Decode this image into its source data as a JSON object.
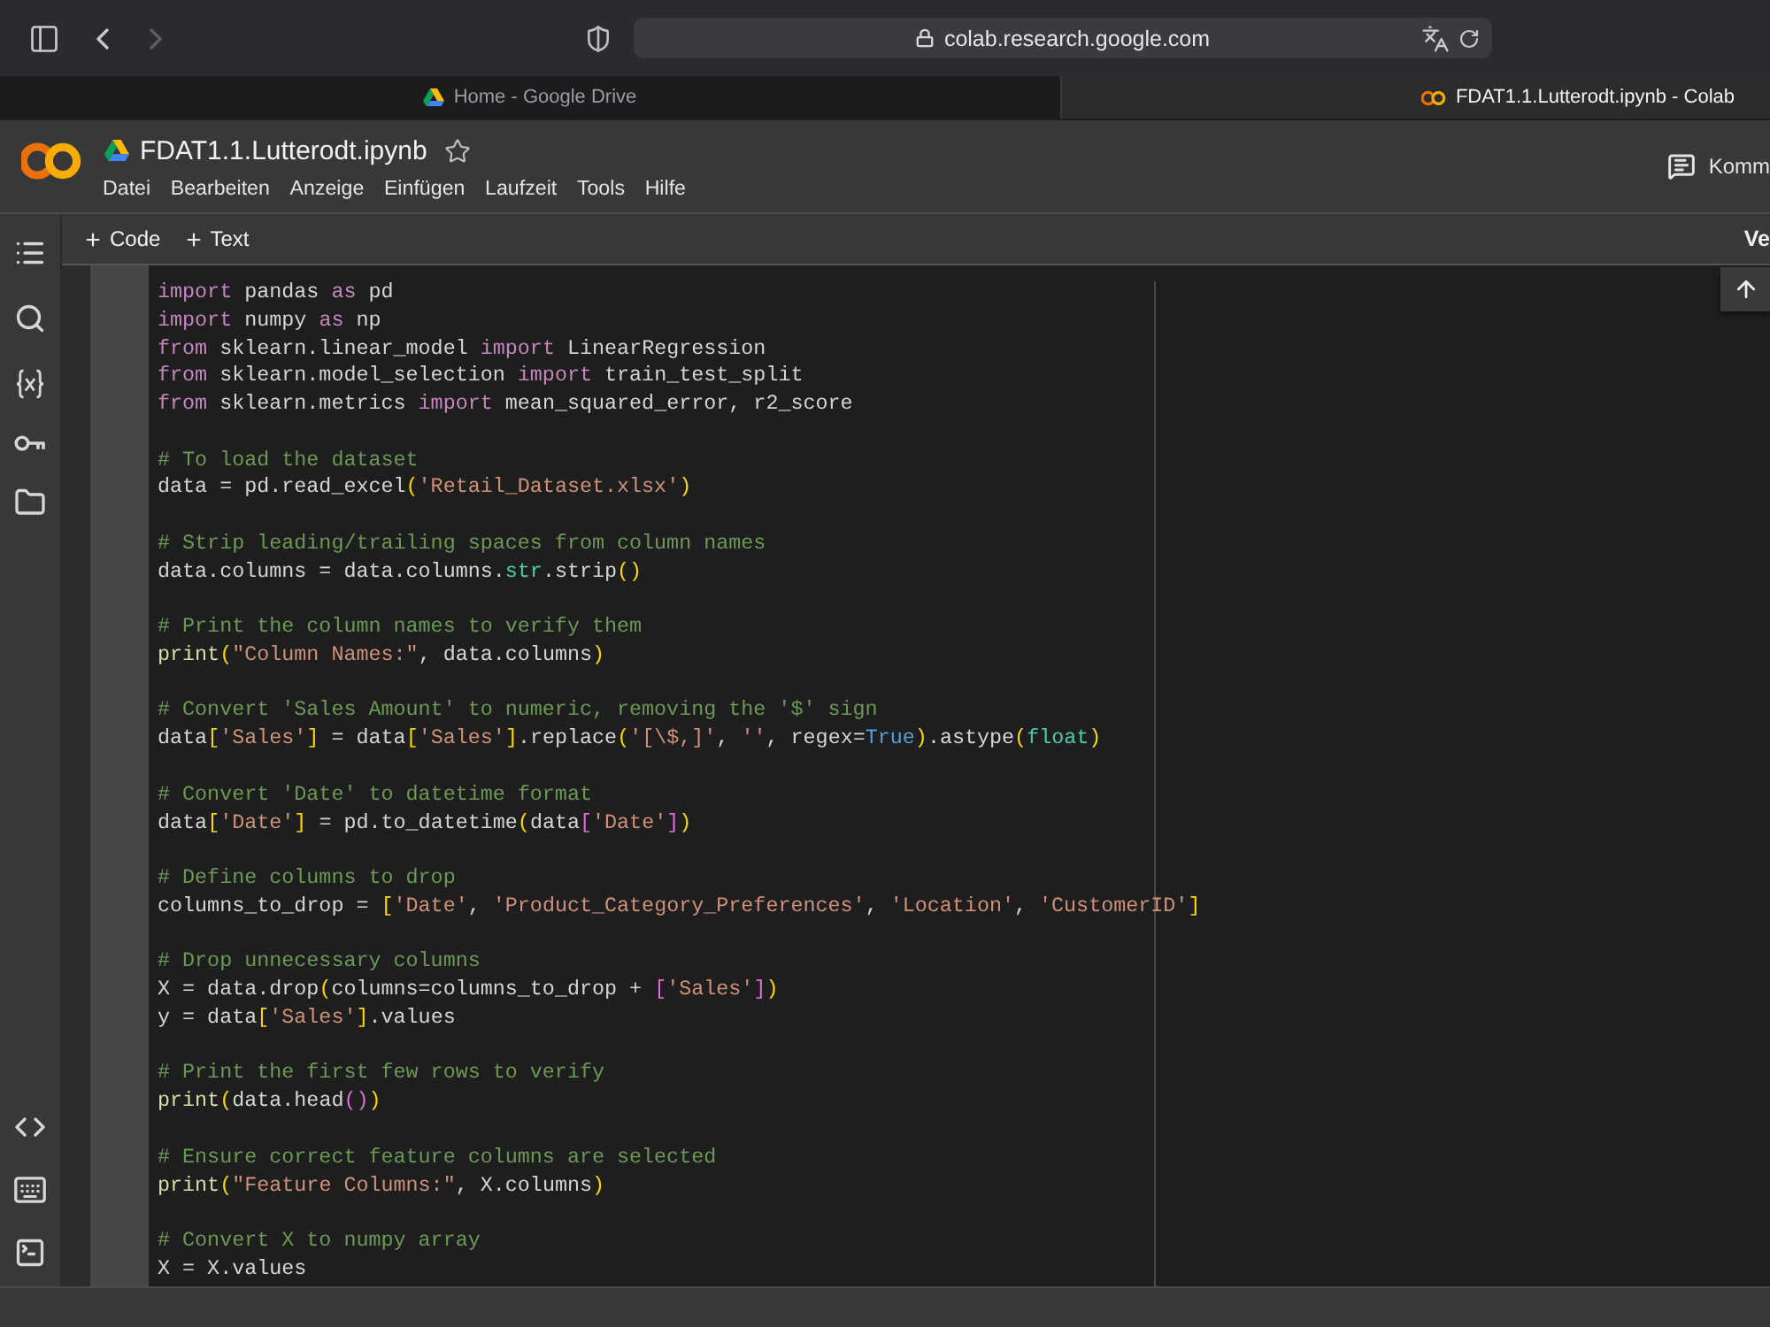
{
  "browser": {
    "back_button": {
      "disabled": false
    },
    "forward_button": {
      "disabled": true
    },
    "address": "colab.research.google.com"
  },
  "tabs": [
    {
      "title": "Home - Google Drive",
      "kind": "drive",
      "selected": false
    },
    {
      "title": "FDAT1.1.Lutterodt.ipynb - Colab",
      "kind": "colab",
      "selected": true
    }
  ],
  "notebook": {
    "title": "FDAT1.1.Lutterodt.ipynb",
    "starred": false,
    "menu": [
      "Datei",
      "Bearbeiten",
      "Anzeige",
      "Einfügen",
      "Laufzeit",
      "Tools",
      "Hilfe"
    ],
    "comments_button": "Komm"
  },
  "toolbar": {
    "add_buttons": [
      "Code",
      "Text"
    ],
    "right_button": "Ve"
  },
  "code_cell": {
    "blocks": [
      {
        "lines": [
          [
            {
              "text": "import",
              "kind": "keyword"
            },
            {
              "text": " pandas ",
              "kind": "plain"
            },
            {
              "text": "as",
              "kind": "keyword"
            },
            {
              "text": " pd",
              "kind": "plain"
            }
          ],
          [
            {
              "text": "import",
              "kind": "keyword"
            },
            {
              "text": " numpy ",
              "kind": "plain"
            },
            {
              "text": "as",
              "kind": "keyword"
            },
            {
              "text": " np",
              "kind": "plain"
            }
          ],
          [
            {
              "text": "from",
              "kind": "keyword"
            },
            {
              "text": " sklearn.linear_model ",
              "kind": "plain"
            },
            {
              "text": "import",
              "kind": "keyword"
            },
            {
              "text": " LinearRegression",
              "kind": "plain"
            }
          ],
          [
            {
              "text": "from",
              "kind": "keyword"
            },
            {
              "text": " sklearn.model_selection ",
              "kind": "plain"
            },
            {
              "text": "import",
              "kind": "keyword"
            },
            {
              "text": " train_test_split",
              "kind": "plain"
            }
          ],
          [
            {
              "text": "from",
              "kind": "keyword"
            },
            {
              "text": " sklearn.metrics ",
              "kind": "plain"
            },
            {
              "text": "import",
              "kind": "keyword"
            },
            {
              "text": " mean_squared_error, r2_score",
              "kind": "plain"
            }
          ]
        ]
      },
      {
        "lines": [
          [
            {
              "text": "# To load the dataset",
              "kind": "comment"
            }
          ],
          [
            {
              "text": "data = pd.read_excel",
              "kind": "plain"
            },
            {
              "text": "(",
              "kind": "bracket"
            },
            {
              "text": "'Retail_Dataset.xlsx'",
              "kind": "string"
            },
            {
              "text": ")",
              "kind": "bracket"
            }
          ]
        ]
      },
      {
        "lines": [
          [
            {
              "text": "# Strip leading/trailing spaces from column names",
              "kind": "comment"
            }
          ],
          [
            {
              "text": "data.columns = data.columns.",
              "kind": "plain"
            },
            {
              "text": "str",
              "kind": "builtin"
            },
            {
              "text": ".strip",
              "kind": "plain"
            },
            {
              "text": "()",
              "kind": "bracket"
            }
          ]
        ]
      },
      {
        "lines": [
          [
            {
              "text": "# Print the column names to verify them",
              "kind": "comment"
            }
          ],
          [
            {
              "text": "print",
              "kind": "function"
            },
            {
              "text": "(",
              "kind": "bracket"
            },
            {
              "text": "\"Column Names:\"",
              "kind": "string"
            },
            {
              "text": ", data.columns",
              "kind": "plain"
            },
            {
              "text": ")",
              "kind": "bracket"
            }
          ]
        ]
      },
      {
        "lines": [
          [
            {
              "text": "# Convert 'Sales Amount' to numeric, removing the '$' sign",
              "kind": "comment"
            }
          ],
          [
            {
              "text": "data",
              "kind": "plain"
            },
            {
              "text": "[",
              "kind": "bracket"
            },
            {
              "text": "'Sales'",
              "kind": "string"
            },
            {
              "text": "]",
              "kind": "bracket"
            },
            {
              "text": " = data",
              "kind": "plain"
            },
            {
              "text": "[",
              "kind": "bracket"
            },
            {
              "text": "'Sales'",
              "kind": "string"
            },
            {
              "text": "]",
              "kind": "bracket"
            },
            {
              "text": ".replace",
              "kind": "plain"
            },
            {
              "text": "(",
              "kind": "bracket"
            },
            {
              "text": "'[\\$,]'",
              "kind": "string"
            },
            {
              "text": ", ",
              "kind": "plain"
            },
            {
              "text": "''",
              "kind": "string"
            },
            {
              "text": ", regex=",
              "kind": "plain"
            },
            {
              "text": "True",
              "kind": "constant"
            },
            {
              "text": ")",
              "kind": "bracket"
            },
            {
              "text": ".astype",
              "kind": "plain"
            },
            {
              "text": "(",
              "kind": "bracket"
            },
            {
              "text": "float",
              "kind": "builtin"
            },
            {
              "text": ")",
              "kind": "bracket"
            }
          ]
        ]
      },
      {
        "lines": [
          [
            {
              "text": "# Convert 'Date' to datetime format",
              "kind": "comment"
            }
          ],
          [
            {
              "text": "data",
              "kind": "plain"
            },
            {
              "text": "[",
              "kind": "bracket"
            },
            {
              "text": "'Date'",
              "kind": "string"
            },
            {
              "text": "]",
              "kind": "bracket"
            },
            {
              "text": " = pd.to_datetime",
              "kind": "plain"
            },
            {
              "text": "(",
              "kind": "bracket"
            },
            {
              "text": "data",
              "kind": "plain"
            },
            {
              "text": "[",
              "kind": "bracket2"
            },
            {
              "text": "'Date'",
              "kind": "string"
            },
            {
              "text": "]",
              "kind": "bracket2"
            },
            {
              "text": ")",
              "kind": "bracket"
            }
          ]
        ]
      },
      {
        "lines": [
          [
            {
              "text": "# Define columns to drop",
              "kind": "comment"
            }
          ],
          [
            {
              "text": "columns_to_drop = ",
              "kind": "plain"
            },
            {
              "text": "[",
              "kind": "bracket"
            },
            {
              "text": "'Date'",
              "kind": "string"
            },
            {
              "text": ", ",
              "kind": "plain"
            },
            {
              "text": "'Product_Category_Preferences'",
              "kind": "string"
            },
            {
              "text": ", ",
              "kind": "plain"
            },
            {
              "text": "'Location'",
              "kind": "string"
            },
            {
              "text": ", ",
              "kind": "plain"
            },
            {
              "text": "'CustomerID'",
              "kind": "string"
            },
            {
              "text": "]",
              "kind": "bracket"
            }
          ]
        ]
      },
      {
        "lines": [
          [
            {
              "text": "# Drop unnecessary columns",
              "kind": "comment"
            }
          ],
          [
            {
              "text": "X = data.drop",
              "kind": "plain"
            },
            {
              "text": "(",
              "kind": "bracket"
            },
            {
              "text": "columns=columns_to_drop + ",
              "kind": "plain"
            },
            {
              "text": "[",
              "kind": "bracket2"
            },
            {
              "text": "'Sales'",
              "kind": "string"
            },
            {
              "text": "]",
              "kind": "bracket2"
            },
            {
              "text": ")",
              "kind": "bracket"
            }
          ],
          [
            {
              "text": "y = data",
              "kind": "plain"
            },
            {
              "text": "[",
              "kind": "bracket"
            },
            {
              "text": "'Sales'",
              "kind": "string"
            },
            {
              "text": "]",
              "kind": "bracket"
            },
            {
              "text": ".values",
              "kind": "plain"
            }
          ]
        ]
      },
      {
        "lines": [
          [
            {
              "text": "# Print the first few rows to verify",
              "kind": "comment"
            }
          ],
          [
            {
              "text": "print",
              "kind": "function"
            },
            {
              "text": "(",
              "kind": "bracket"
            },
            {
              "text": "data.head",
              "kind": "plain"
            },
            {
              "text": "()",
              "kind": "bracket2"
            },
            {
              "text": ")",
              "kind": "bracket"
            }
          ]
        ]
      },
      {
        "lines": [
          [
            {
              "text": "# Ensure correct feature columns are selected",
              "kind": "comment"
            }
          ],
          [
            {
              "text": "print",
              "kind": "function"
            },
            {
              "text": "(",
              "kind": "bracket"
            },
            {
              "text": "\"Feature Columns:\"",
              "kind": "string"
            },
            {
              "text": ", X.columns",
              "kind": "plain"
            },
            {
              "text": ")",
              "kind": "bracket"
            }
          ]
        ]
      },
      {
        "lines": [
          [
            {
              "text": "# Convert X to numpy array",
              "kind": "comment"
            }
          ],
          [
            {
              "text": "X = X.values",
              "kind": "plain"
            }
          ]
        ]
      }
    ]
  }
}
